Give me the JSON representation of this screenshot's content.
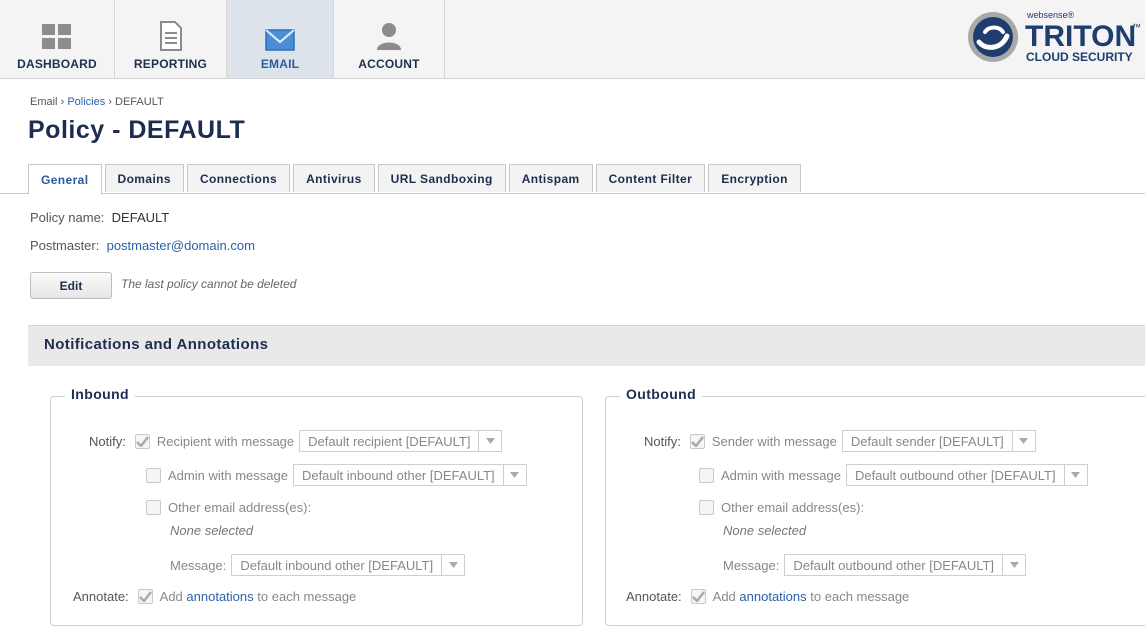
{
  "nav": {
    "dashboard": "DASHBOARD",
    "reporting": "REPORTING",
    "email": "EMAIL",
    "account": "ACCOUNT"
  },
  "logo": {
    "brand_small": "websense®",
    "brand_main": "TRITON",
    "brand_tm": "™",
    "brand_sub": "CLOUD SECURITY"
  },
  "breadcrumb": {
    "root": "Email",
    "sep": "›",
    "policies": "Policies",
    "current": "DEFAULT"
  },
  "page_title": "Policy - DEFAULT",
  "tabs": [
    "General",
    "Domains",
    "Connections",
    "Antivirus",
    "URL Sandboxing",
    "Antispam",
    "Content Filter",
    "Encryption"
  ],
  "policy": {
    "name_label": "Policy name:",
    "name_value": "DEFAULT",
    "postmaster_label": "Postmaster:",
    "postmaster_value": "postmaster@domain.com",
    "edit_label": "Edit",
    "edit_note": "The last policy cannot be deleted"
  },
  "section_title": "Notifications and Annotations",
  "inbound": {
    "legend": "Inbound",
    "notify_label": "Notify:",
    "recipient_label": "Recipient with message",
    "recipient_select": "Default recipient [DEFAULT]",
    "admin_label": "Admin with message",
    "admin_select": "Default inbound other [DEFAULT]",
    "other_label": "Other email address(es):",
    "none_selected": "None selected",
    "message_label": "Message:",
    "message_select": "Default inbound other [DEFAULT]",
    "annotate_label": "Annotate:",
    "annotate_pre": "Add",
    "annotate_link": "annotations",
    "annotate_post": "to each message"
  },
  "outbound": {
    "legend": "Outbound",
    "notify_label": "Notify:",
    "sender_label": "Sender with message",
    "sender_select": "Default sender [DEFAULT]",
    "admin_label": "Admin with message",
    "admin_select": "Default outbound other [DEFAULT]",
    "other_label": "Other email address(es):",
    "none_selected": "None selected",
    "message_label": "Message:",
    "message_select": "Default outbound other [DEFAULT]",
    "annotate_label": "Annotate:",
    "annotate_pre": "Add",
    "annotate_link": "annotations",
    "annotate_post": "to each message"
  },
  "colors": {
    "accent": "#2a62a8",
    "title": "#1d2d4f"
  }
}
